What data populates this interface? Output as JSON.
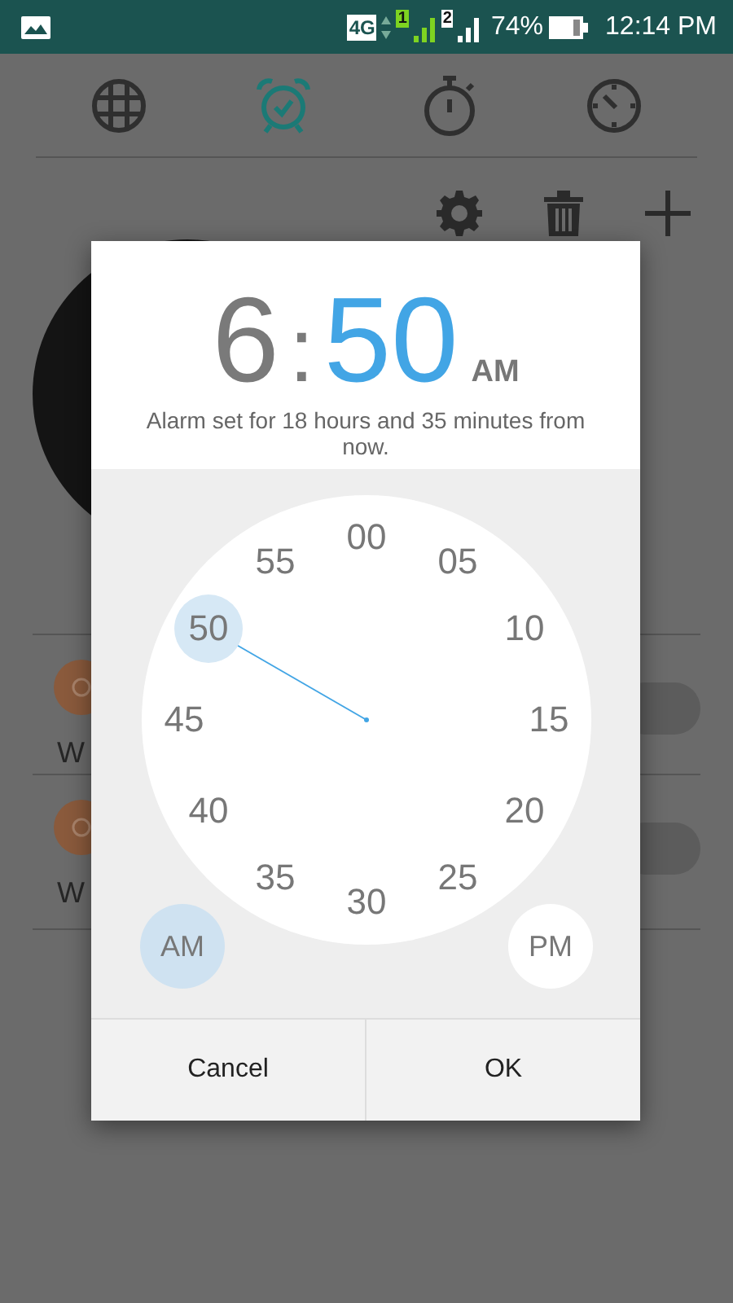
{
  "status_bar": {
    "network": "4G",
    "sim_1": "1",
    "sim_2": "2",
    "battery": "74%",
    "time": "12:14 PM"
  },
  "tabs": [
    {
      "selected": false
    },
    {
      "selected": true
    },
    {
      "selected": false
    },
    {
      "selected": false
    }
  ],
  "alarms": [
    {
      "label": "W",
      "on": false
    },
    {
      "label": "W",
      "on": false
    }
  ],
  "dialog": {
    "hour": "6",
    "separator": ":",
    "minute": "50",
    "period": "AM",
    "message": "Alarm set for 18 hours and 35 minutes from now.",
    "minutes": [
      {
        "label": "00",
        "selected": false
      },
      {
        "label": "05",
        "selected": false
      },
      {
        "label": "10",
        "selected": false
      },
      {
        "label": "15",
        "selected": false
      },
      {
        "label": "20",
        "selected": false
      },
      {
        "label": "25",
        "selected": false
      },
      {
        "label": "30",
        "selected": false
      },
      {
        "label": "35",
        "selected": false
      },
      {
        "label": "40",
        "selected": false
      },
      {
        "label": "45",
        "selected": false
      },
      {
        "label": "50",
        "selected": true
      },
      {
        "label": "55",
        "selected": false
      }
    ],
    "periods": [
      {
        "label": "AM",
        "selected": true
      },
      {
        "label": "PM",
        "selected": false
      }
    ],
    "buttons": [
      "Cancel",
      "OK"
    ]
  }
}
